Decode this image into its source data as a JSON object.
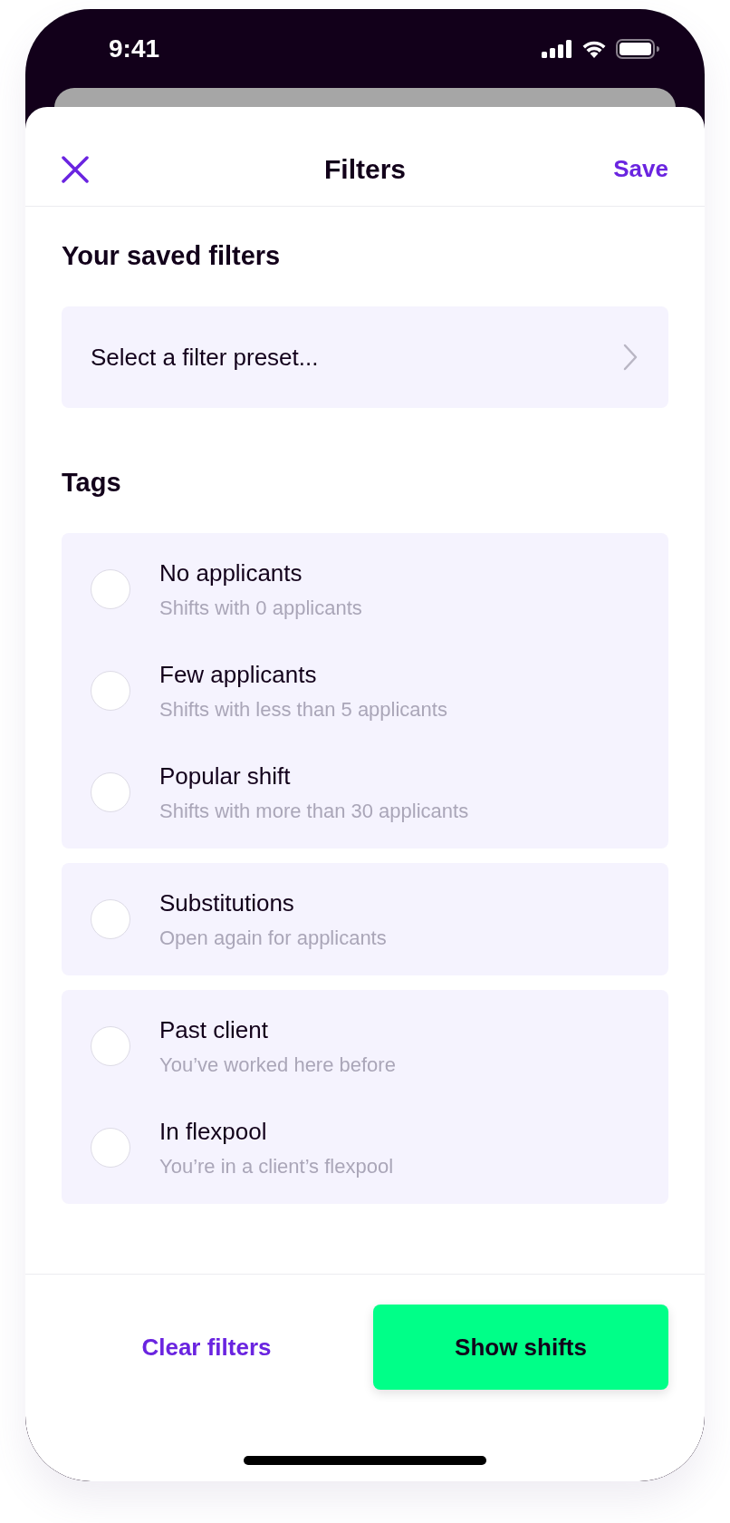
{
  "status_bar": {
    "time": "9:41"
  },
  "header": {
    "title": "Filters",
    "save": "Save"
  },
  "saved_filters": {
    "heading": "Your saved filters",
    "placeholder": "Select a filter preset..."
  },
  "tags": {
    "heading": "Tags",
    "groups": [
      {
        "items": [
          {
            "title": "No applicants",
            "subtitle": "Shifts with 0 applicants",
            "checked": false
          },
          {
            "title": "Few applicants",
            "subtitle": "Shifts with less than 5 applicants",
            "checked": false
          },
          {
            "title": "Popular shift",
            "subtitle": "Shifts with more than 30 applicants",
            "checked": false
          }
        ]
      },
      {
        "items": [
          {
            "title": "Substitutions",
            "subtitle": "Open again for applicants",
            "checked": false
          }
        ]
      },
      {
        "items": [
          {
            "title": "Past client",
            "subtitle": "You’ve worked here before",
            "checked": false
          },
          {
            "title": "In flexpool",
            "subtitle": "You’re in a client’s flexpool",
            "checked": false
          }
        ]
      }
    ]
  },
  "footer": {
    "clear": "Clear filters",
    "show": "Show shifts"
  }
}
